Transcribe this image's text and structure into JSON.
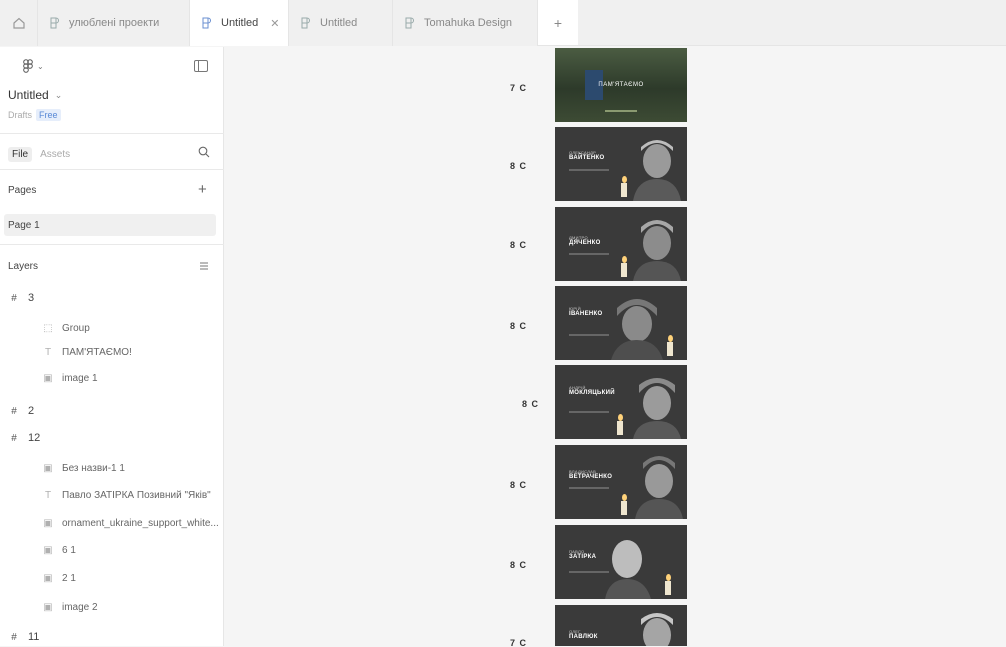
{
  "tabs": [
    {
      "label": "улюблені проекти"
    },
    {
      "label": "Untitled",
      "active": true
    },
    {
      "label": "Untitled"
    },
    {
      "label": "Tomahuka Design"
    }
  ],
  "sidebar": {
    "file_name": "Untitled",
    "drafts": "Drafts",
    "plan": "Free",
    "file_tab": "File",
    "assets_tab": "Assets",
    "pages_heading": "Pages",
    "pages": [
      "Page 1"
    ],
    "layers_heading": "Layers",
    "layers": [
      {
        "type": "frame",
        "name": "3"
      },
      {
        "type": "group",
        "name": "Group"
      },
      {
        "type": "text",
        "name": "ПАМ'ЯТАЄМО!"
      },
      {
        "type": "image",
        "name": "image 1"
      },
      {
        "type": "frame",
        "name": "2"
      },
      {
        "type": "frame",
        "name": "12"
      },
      {
        "type": "image",
        "name": "Без назви-1 1"
      },
      {
        "type": "text",
        "name": "Павло ЗАТІРКА Позивний \"Яків\""
      },
      {
        "type": "image",
        "name": "ornament_ukraine_support_white..."
      },
      {
        "type": "image",
        "name": "6 1"
      },
      {
        "type": "image",
        "name": "2 1"
      },
      {
        "type": "image",
        "name": "image 2"
      },
      {
        "type": "frame",
        "name": "11"
      }
    ]
  },
  "canvas": {
    "frames": [
      {
        "label": "7 C",
        "title": "ПАМ'ЯТАЄМО"
      },
      {
        "label": "8 C",
        "small": "ОЛЕКСАНДР",
        "big": "ВАЙТЕНКО"
      },
      {
        "label": "8 C",
        "small": "ДМИТРО",
        "big": "ДЯЧЕНКО"
      },
      {
        "label": "8 C",
        "small": "ЮРІЙ",
        "big": "ІВАНЕНКО"
      },
      {
        "label": "8 C",
        "small": "АНДРІЙ",
        "big": "МОКЛЯЦЬКИЙ"
      },
      {
        "label": "8 C",
        "small": "ВЛАДИСЛАВ",
        "big": "ВЕТРАЧЕНКО"
      },
      {
        "label": "8 C",
        "small": "ПАВЛО",
        "big": "ЗАТІРКА"
      },
      {
        "label": "7 C",
        "small": "ОЛЕГ",
        "big": "ПАВЛЮК"
      }
    ]
  }
}
